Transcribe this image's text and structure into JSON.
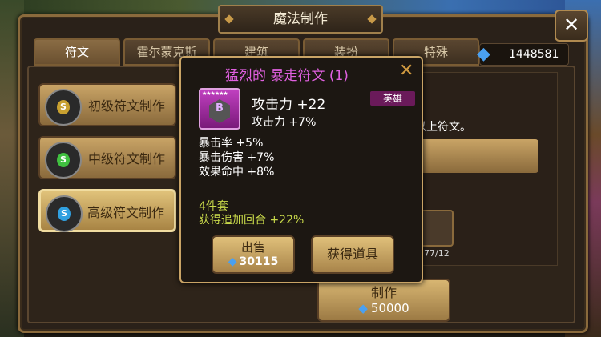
{
  "header": {
    "title": "魔法制作",
    "close_label": "✕"
  },
  "tabs": [
    {
      "label": "符文",
      "active": true
    },
    {
      "label": "霍尔蒙克斯"
    },
    {
      "label": "建筑"
    },
    {
      "label": "装扮"
    },
    {
      "label": "特殊"
    }
  ],
  "currency": {
    "crystals": "1448581"
  },
  "recipes": [
    {
      "label": "初级符文制作",
      "badge": "S",
      "color": "#c8a030"
    },
    {
      "label": "中级符文制作",
      "badge": "S",
      "color": "#40c040"
    },
    {
      "label": "高级符文制作",
      "badge": "S",
      "color": "#30a0e0",
      "selected": true
    }
  ],
  "right": {
    "hint": "以上符文。",
    "rune_count": "177/12"
  },
  "craft": {
    "label": "制作",
    "cost": "50000"
  },
  "popup": {
    "title": "猛烈的 暴走符文 (1)",
    "close": "✕",
    "rune_letter": "B",
    "rune_stars": "★★★★★★",
    "main_stat": "攻击力 +22",
    "prefix_stat": "攻击力 +7%",
    "grade": "英雄",
    "substats": [
      "暴击率 +5%",
      "暴击伤害 +7%",
      "效果命中 +8%"
    ],
    "set_name": "4件套",
    "set_bonus": "获得追加回合 +22%",
    "sell_label": "出售",
    "sell_price": "30115",
    "obtain_label": "获得道具"
  },
  "colors": {
    "accent_gold": "#c9a466",
    "rune_purple": "#c040c0",
    "crystal_blue": "#4aa0f0"
  }
}
